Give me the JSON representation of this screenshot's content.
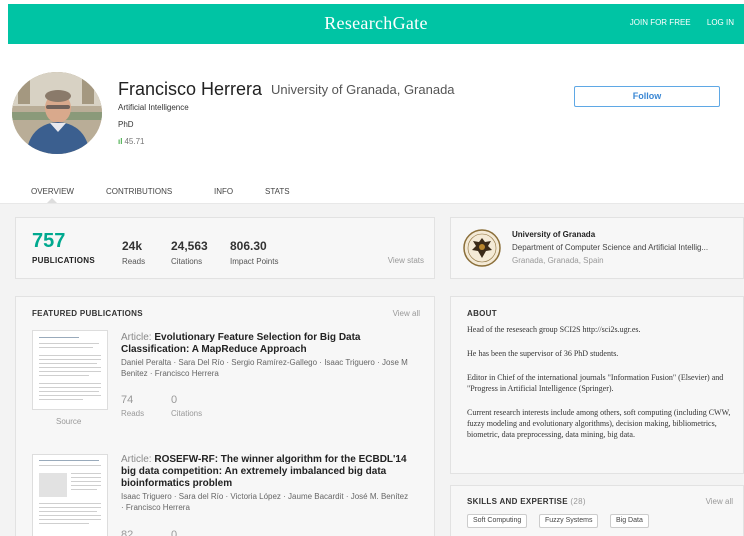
{
  "header": {
    "brand": "ResearchGate",
    "join": "JOIN FOR FREE",
    "login": "LOG IN"
  },
  "profile": {
    "name": "Francisco Herrera",
    "institution": "University of Granada, Granada",
    "field": "Artificial Intelligence",
    "degree": "PhD",
    "score": "45.71",
    "follow_label": "Follow"
  },
  "tabs": [
    "OVERVIEW",
    "CONTRIBUTIONS",
    "INFO",
    "STATS"
  ],
  "stats": {
    "publications": "757",
    "publications_label": "PUBLICATIONS",
    "reads": "24k",
    "reads_label": "Reads",
    "citations": "24,563",
    "citations_label": "Citations",
    "impact": "806.30",
    "impact_label": "Impact Points",
    "view_stats": "View stats"
  },
  "institution_card": {
    "name": "University of Granada",
    "department": "Department of Computer Science and Artificial Intellig...",
    "location": "Granada, Granada, Spain"
  },
  "featured": {
    "title": "FEATURED PUBLICATIONS",
    "view_all": "View all",
    "items": [
      {
        "type": "Article:",
        "title": "Evolutionary Feature Selection for Big Data Classification: A MapReduce Approach",
        "authors": "Daniel Peralta · Sara Del Río · Sergio Ramírez-Gallego · Isaac Triguero · Jose M Benitez · Francisco Herrera",
        "reads": "74",
        "reads_label": "Reads",
        "citations": "0",
        "citations_label": "Citations",
        "source": "Source"
      },
      {
        "type": "Article:",
        "title": "ROSEFW-RF: The winner algorithm for the ECBDL'14 big data competition: An extremely imbalanced big data bioinformatics problem",
        "authors": "Isaac Triguero · Sara del Río · Victoria López · Jaume Bacardit · José M. Benítez · Francisco Herrera",
        "reads": "82",
        "citations": "0"
      }
    ]
  },
  "about": {
    "title": "ABOUT",
    "paragraphs": [
      "Head of the reseseach group SCI2S http://sci2s.ugr.es.",
      "He has been the supervisor of 36 PhD students.",
      "Editor in Chief of the international journals \"Information Fusion\" (Elsevier) and \"Progress in Artificial Intelligence (Springer).",
      "Current research interests include among others, soft computing (including CWW, fuzzy modeling and evolutionary algorithms), decision making, bibliometrics, biometric, data preprocessing, data mining, big data."
    ]
  },
  "skills": {
    "title": "SKILLS AND EXPERTISE",
    "count": "(28)",
    "view_all": "View all",
    "items": [
      "Soft Computing",
      "Fuzzy Systems",
      "Big Data"
    ]
  },
  "colors": {
    "brand": "#00c4a4",
    "accent_green": "#00a98f",
    "follow_blue": "#3a87d4"
  }
}
